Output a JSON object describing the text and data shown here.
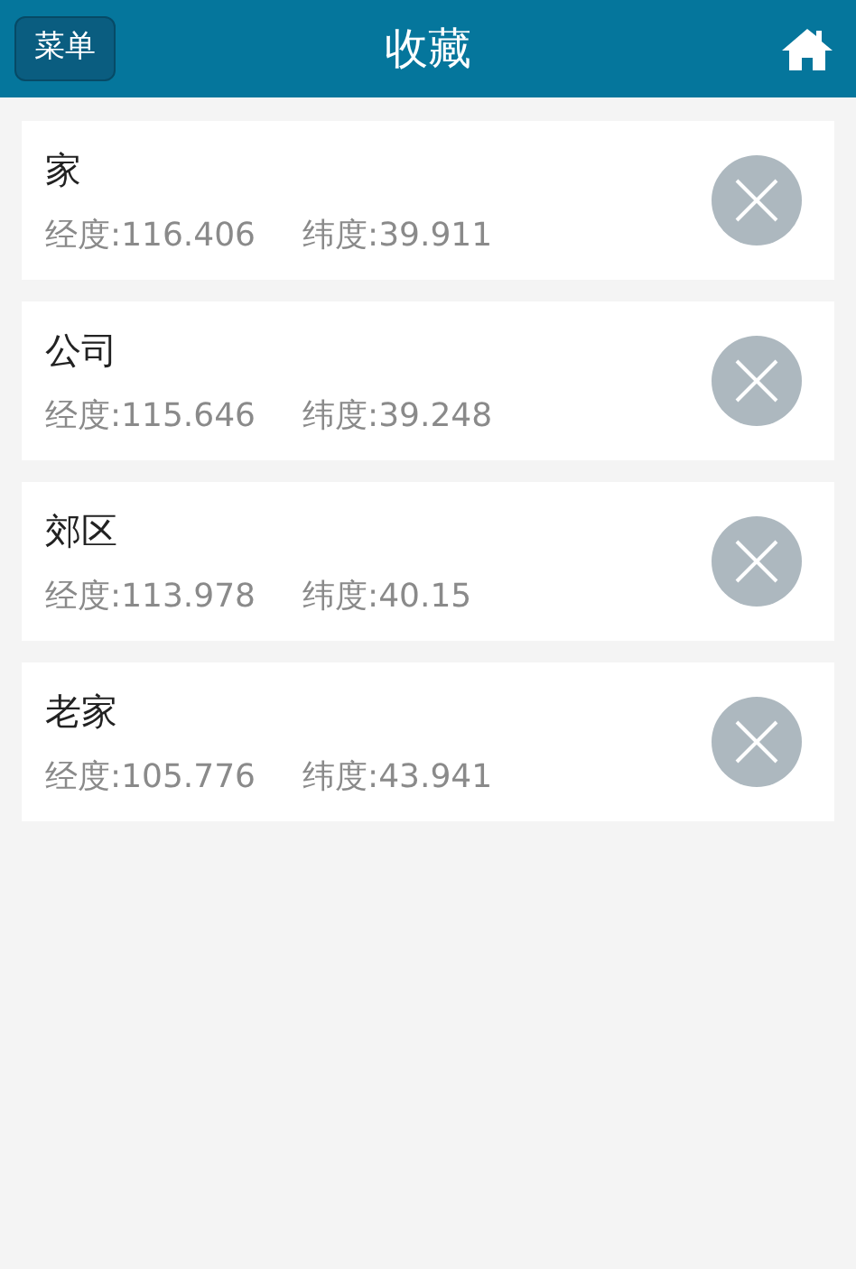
{
  "header": {
    "menu_button": "菜单",
    "title": "收藏"
  },
  "favorites": [
    {
      "name": "家",
      "longitude": "经度:116.406",
      "latitude": "纬度:39.911"
    },
    {
      "name": "公司",
      "longitude": "经度:115.646",
      "latitude": "纬度:39.248"
    },
    {
      "name": "郊区",
      "longitude": "经度:113.978",
      "latitude": "纬度:40.15"
    },
    {
      "name": "老家",
      "longitude": "经度:105.776",
      "latitude": "纬度:43.941"
    }
  ]
}
